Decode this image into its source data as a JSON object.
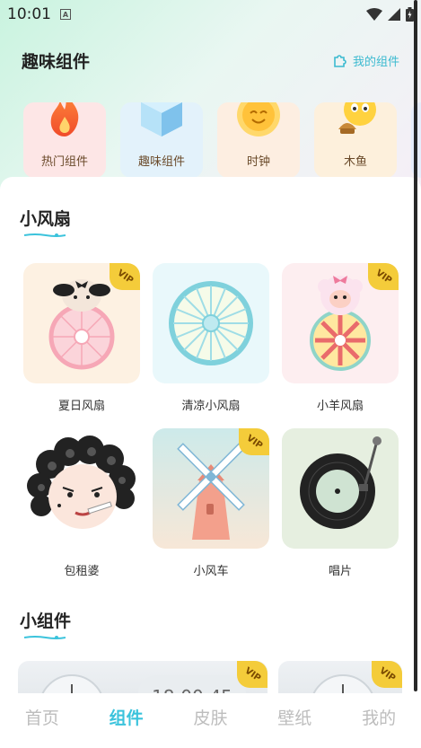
{
  "status_bar": {
    "time": "10:01",
    "notif_letter": "A"
  },
  "header": {
    "title": "趣味组件",
    "my_widgets_label": "我的组件"
  },
  "categories": [
    {
      "label": "热门组件",
      "bg": "#fde6e6",
      "icon": "flame-icon"
    },
    {
      "label": "趣味组件",
      "bg": "#e6f3fb",
      "icon": "cube-icon"
    },
    {
      "label": "时钟",
      "bg": "#fdeee1",
      "icon": "smiley-clock-icon"
    },
    {
      "label": "木鱼",
      "bg": "#fdf0dc",
      "icon": "emoji-bell-icon"
    }
  ],
  "sections": {
    "fans": {
      "title": "小风扇"
    },
    "widgets": {
      "title": "小组件"
    }
  },
  "cards": [
    {
      "label": "夏日风扇",
      "vip": true,
      "bg": "#fdf1e2"
    },
    {
      "label": "清凉小风扇",
      "vip": false,
      "bg": "#e9f8fb"
    },
    {
      "label": "小羊风扇",
      "vip": true,
      "bg": "#fdeef0"
    },
    {
      "label": "包租婆",
      "vip": false,
      "bg": "#ffffff"
    },
    {
      "label": "小风车",
      "vip": true,
      "bg": "#cdeaea"
    },
    {
      "label": "唱片",
      "vip": false,
      "bg": "#e6efe0"
    }
  ],
  "vip_text": "VIP",
  "widget_preview": {
    "clock_text": "18:00:45"
  },
  "tabs": [
    {
      "label": "首页",
      "active": false
    },
    {
      "label": "组件",
      "active": true
    },
    {
      "label": "皮肤",
      "active": false
    },
    {
      "label": "壁纸",
      "active": false
    },
    {
      "label": "我的",
      "active": false
    }
  ],
  "colors": {
    "accent": "#3bc3dc",
    "vip": "#f4cc3a"
  }
}
